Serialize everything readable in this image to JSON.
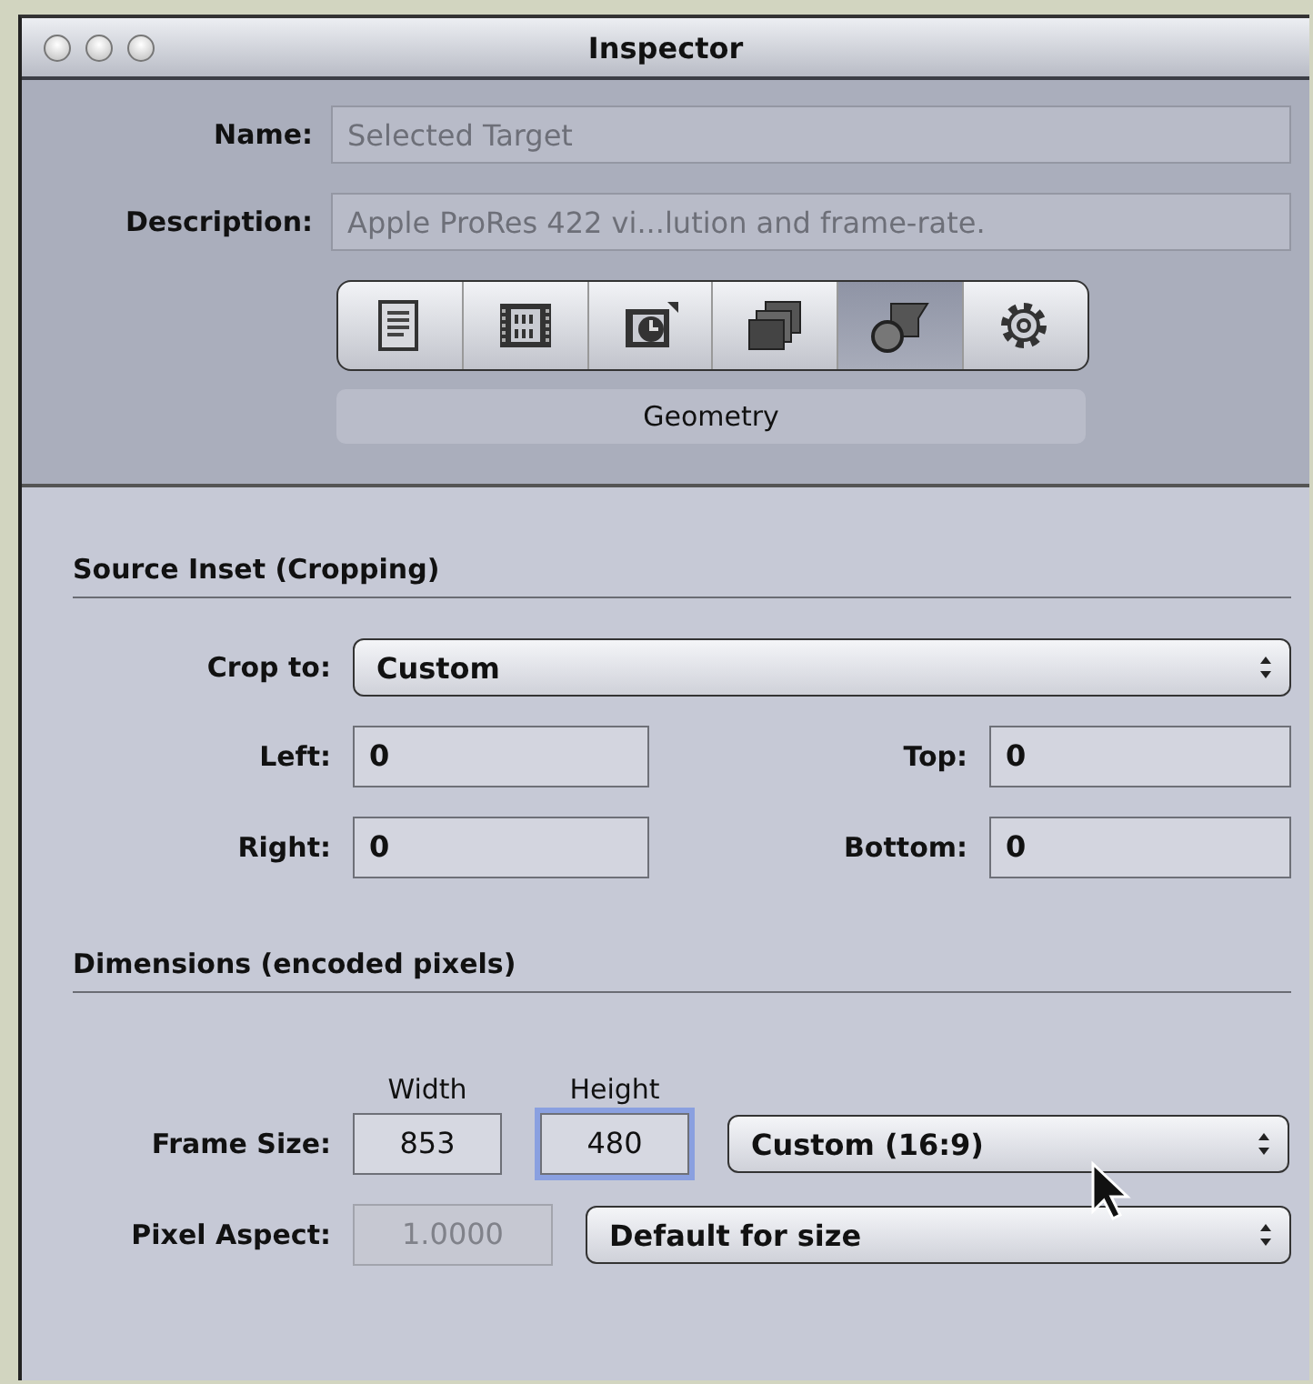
{
  "window": {
    "title": "Inspector"
  },
  "fields": [
    {
      "label": "Name:",
      "value": "Selected Target",
      "disabled": true
    },
    {
      "label": "Description:",
      "value": "Apple ProRes 422 vi...lution and frame-rate.",
      "disabled": true
    }
  ],
  "tabs": [
    {
      "kind": "document",
      "selected": false
    },
    {
      "kind": "film",
      "selected": false
    },
    {
      "kind": "clock",
      "selected": false
    },
    {
      "kind": "layers",
      "selected": false
    },
    {
      "kind": "shapes",
      "selected": true
    },
    {
      "kind": "gear",
      "selected": false
    }
  ],
  "panel_title": "Geometry",
  "source_inset": {
    "heading": "Source Inset (Cropping)",
    "crop_to": {
      "label": "Crop to:",
      "value": "Custom"
    },
    "fields": [
      {
        "label": "Left:",
        "value": "0"
      },
      {
        "label": "Top:",
        "value": "0"
      },
      {
        "label": "Right:",
        "value": "0"
      },
      {
        "label": "Bottom:",
        "value": "0"
      }
    ]
  },
  "dimensions": {
    "heading": "Dimensions (encoded pixels)",
    "column_labels": [
      "Width",
      "Height"
    ],
    "frame_size": {
      "label": "Frame Size:",
      "width": {
        "value": "853",
        "focused": false
      },
      "height": {
        "value": "480",
        "focused": true
      },
      "preset": "Custom (16:9)"
    },
    "pixel_aspect": {
      "label": "Pixel Aspect:",
      "value": "1.0000",
      "disabled": true,
      "preset": "Default for size"
    }
  }
}
